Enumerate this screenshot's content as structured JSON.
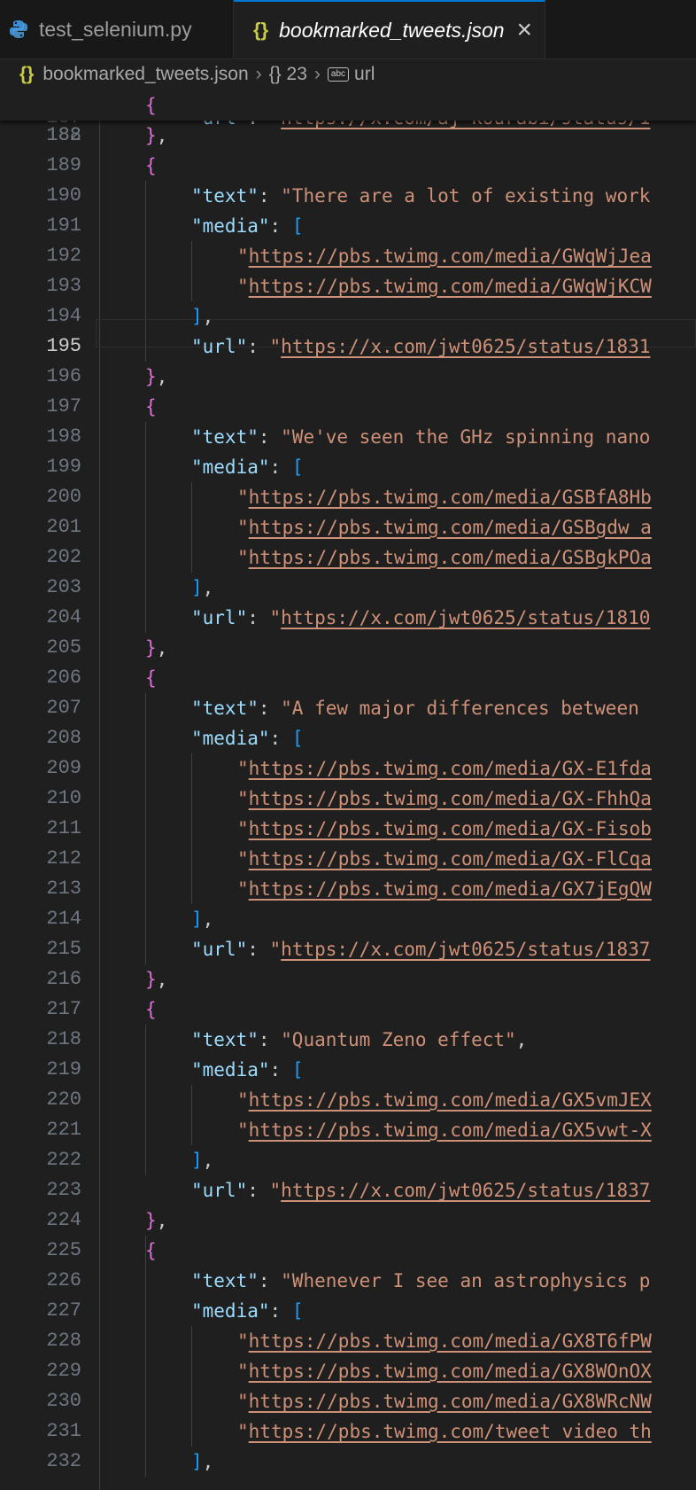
{
  "tabs": [
    {
      "label": "test_selenium.py",
      "icon": "python-icon",
      "active": false
    },
    {
      "label": "bookmarked_tweets.json",
      "icon": "json-braces-icon",
      "active": true
    }
  ],
  "breadcrumb": {
    "file": "bookmarked_tweets.json",
    "object": "{} 23",
    "key": "url"
  },
  "sticky_line": {
    "number": "182",
    "text": "{"
  },
  "partial_line": {
    "number": "187",
    "text": "\"url\": \"https://x.com/aj_kourabi/status/1"
  },
  "active_line": "195",
  "lines": [
    {
      "n": "188",
      "t": "},"
    },
    {
      "n": "189",
      "t": "{"
    },
    {
      "n": "190",
      "t": "\"text\": \"There are a lot of existing work"
    },
    {
      "n": "191",
      "t": "\"media\": ["
    },
    {
      "n": "192",
      "t": "\"https://pbs.twimg.com/media/GWqWjJea"
    },
    {
      "n": "193",
      "t": "\"https://pbs.twimg.com/media/GWqWjKCW"
    },
    {
      "n": "194",
      "t": "],"
    },
    {
      "n": "195",
      "t": "\"url\": \"https://x.com/jwt0625/status/1831"
    },
    {
      "n": "196",
      "t": "},"
    },
    {
      "n": "197",
      "t": "{"
    },
    {
      "n": "198",
      "t": "\"text\": \"We've seen the GHz spinning nano"
    },
    {
      "n": "199",
      "t": "\"media\": ["
    },
    {
      "n": "200",
      "t": "\"https://pbs.twimg.com/media/GSBfA8Hb"
    },
    {
      "n": "201",
      "t": "\"https://pbs.twimg.com/media/GSBgdw_a"
    },
    {
      "n": "202",
      "t": "\"https://pbs.twimg.com/media/GSBgkPOa"
    },
    {
      "n": "203",
      "t": "],"
    },
    {
      "n": "204",
      "t": "\"url\": \"https://x.com/jwt0625/status/1810"
    },
    {
      "n": "205",
      "t": "},"
    },
    {
      "n": "206",
      "t": "{"
    },
    {
      "n": "207",
      "t": "\"text\": \"A few major differences between "
    },
    {
      "n": "208",
      "t": "\"media\": ["
    },
    {
      "n": "209",
      "t": "\"https://pbs.twimg.com/media/GX-E1fda"
    },
    {
      "n": "210",
      "t": "\"https://pbs.twimg.com/media/GX-FhhQa"
    },
    {
      "n": "211",
      "t": "\"https://pbs.twimg.com/media/GX-Fisob"
    },
    {
      "n": "212",
      "t": "\"https://pbs.twimg.com/media/GX-FlCqa"
    },
    {
      "n": "213",
      "t": "\"https://pbs.twimg.com/media/GX7jEgQW"
    },
    {
      "n": "214",
      "t": "],"
    },
    {
      "n": "215",
      "t": "\"url\": \"https://x.com/jwt0625/status/1837"
    },
    {
      "n": "216",
      "t": "},"
    },
    {
      "n": "217",
      "t": "{"
    },
    {
      "n": "218",
      "t": "\"text\": \"Quantum Zeno effect\","
    },
    {
      "n": "219",
      "t": "\"media\": ["
    },
    {
      "n": "220",
      "t": "\"https://pbs.twimg.com/media/GX5vmJEX"
    },
    {
      "n": "221",
      "t": "\"https://pbs.twimg.com/media/GX5vwt-X"
    },
    {
      "n": "222",
      "t": "],"
    },
    {
      "n": "223",
      "t": "\"url\": \"https://x.com/jwt0625/status/1837"
    },
    {
      "n": "224",
      "t": "},"
    },
    {
      "n": "225",
      "t": "{"
    },
    {
      "n": "226",
      "t": "\"text\": \"Whenever I see an astrophysics p"
    },
    {
      "n": "227",
      "t": "\"media\": ["
    },
    {
      "n": "228",
      "t": "\"https://pbs.twimg.com/media/GX8T6fPW"
    },
    {
      "n": "229",
      "t": "\"https://pbs.twimg.com/media/GX8WOnOX"
    },
    {
      "n": "230",
      "t": "\"https://pbs.twimg.com/media/GX8WRcNW"
    },
    {
      "n": "231",
      "t": "\"https://pbs.twimg.com/tweet_video_th"
    },
    {
      "n": "232",
      "t": "],"
    }
  ],
  "colors": {
    "key": "#9cdcfe",
    "string": "#ce9178",
    "bracket_level1": "#da70d6",
    "bracket_level2": "#179fff",
    "accent": "#0078d4"
  }
}
